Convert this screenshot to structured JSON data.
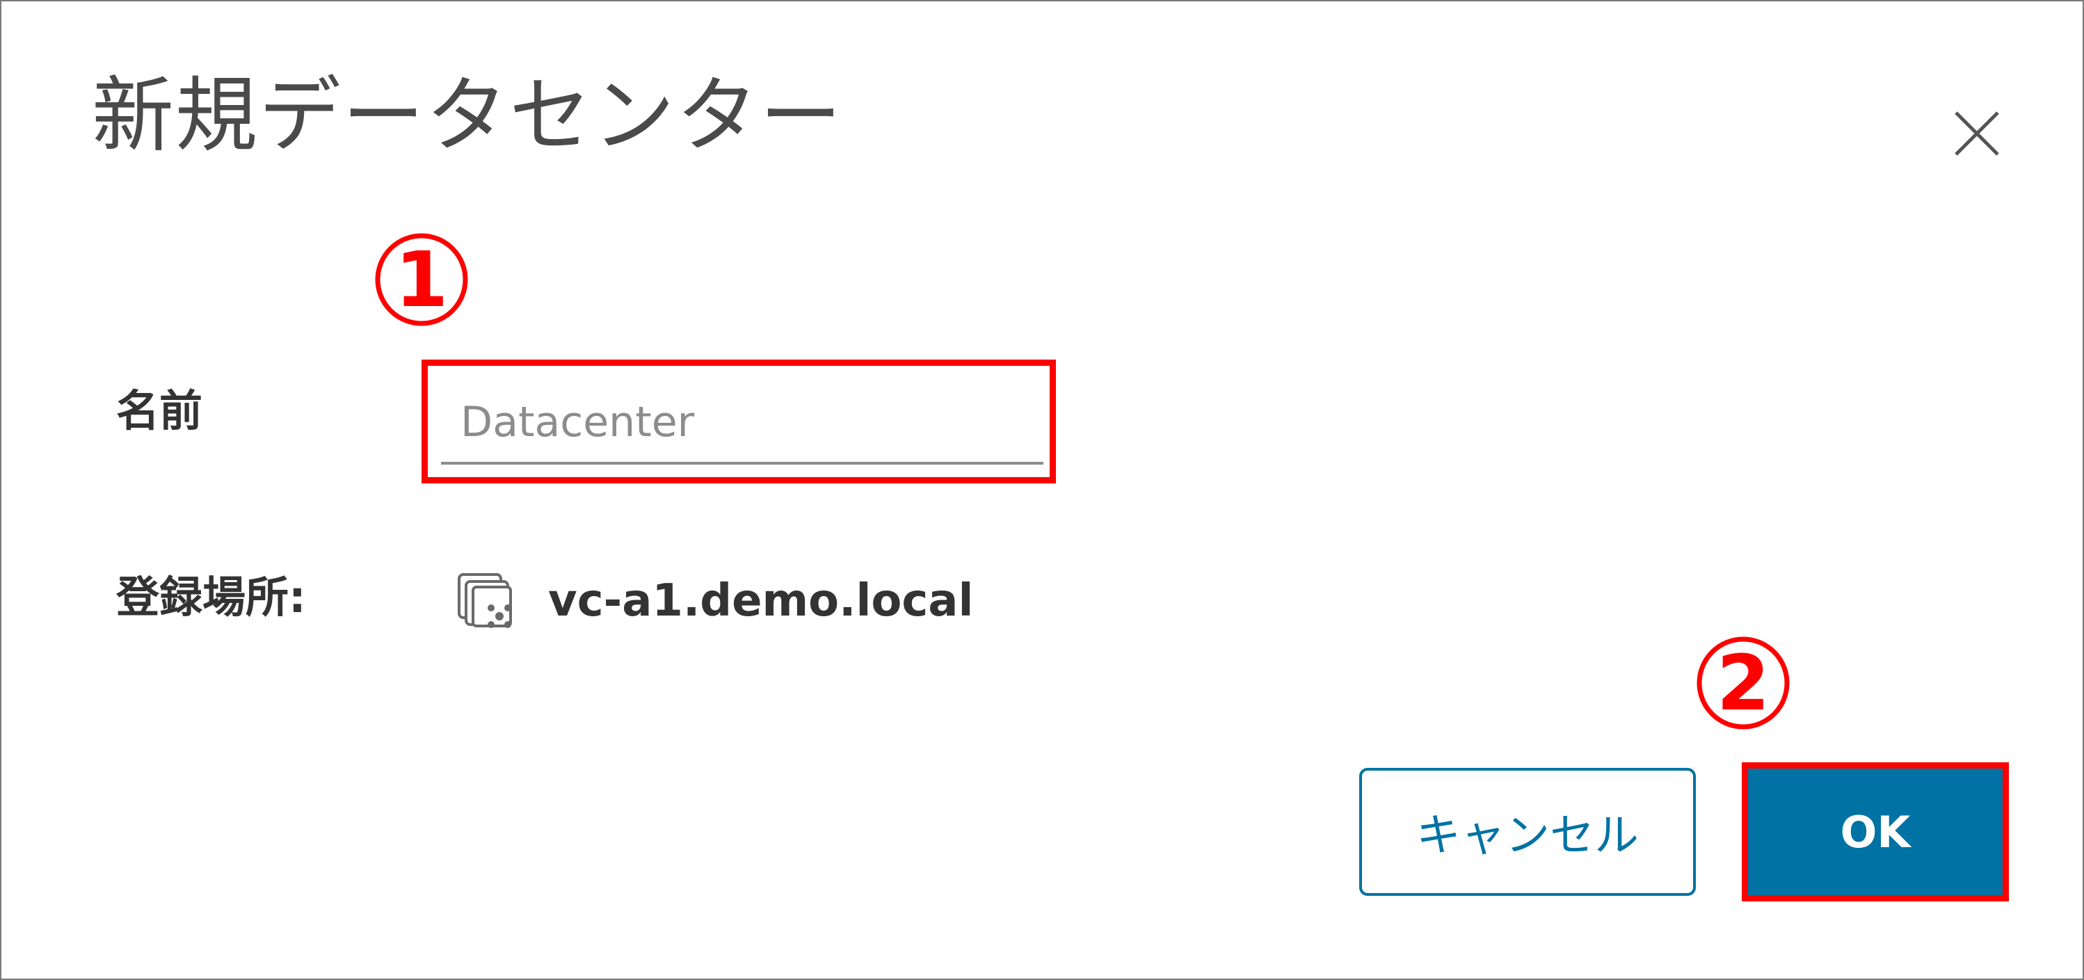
{
  "dialog": {
    "title": "新規データセンター",
    "close_icon": "close-icon"
  },
  "annotations": {
    "step1": "1",
    "step2": "2",
    "highlight_color": "#ff0000"
  },
  "form": {
    "name_label": "名前",
    "name_placeholder": "Datacenter",
    "location_label": "登録場所:",
    "location_icon": "vcenter-icon",
    "location_value": "vc-a1.demo.local"
  },
  "buttons": {
    "cancel_label": "キャンセル",
    "ok_label": "OK"
  },
  "colors": {
    "accent": "#0072a3",
    "title_text": "#4a4a4a"
  }
}
